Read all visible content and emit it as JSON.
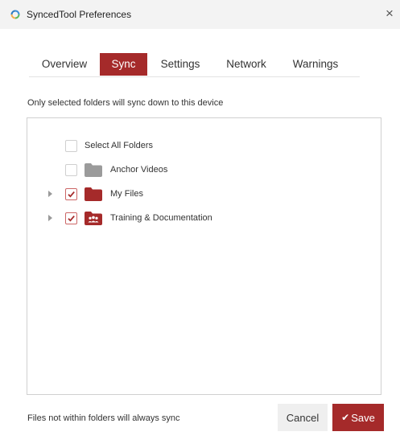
{
  "window": {
    "title": "SyncedTool Preferences",
    "app_icon": "sync-app-icon",
    "close_glyph": "×"
  },
  "tabs": [
    {
      "label": "Overview",
      "active": false
    },
    {
      "label": "Sync",
      "active": true
    },
    {
      "label": "Settings",
      "active": false
    },
    {
      "label": "Network",
      "active": false
    },
    {
      "label": "Warnings",
      "active": false
    }
  ],
  "sync": {
    "subtitle": "Only selected folders will sync down to this device",
    "select_all": {
      "label": "Select All Folders",
      "checked": false
    },
    "folders": [
      {
        "label": "Anchor Videos",
        "checked": false,
        "expandable": false,
        "icon": "folder-icon",
        "icon_color": "#9b9b9b"
      },
      {
        "label": "My Files",
        "checked": true,
        "expandable": true,
        "icon": "folder-icon",
        "icon_color": "#a52a2a"
      },
      {
        "label": "Training & Documentation",
        "checked": true,
        "expandable": true,
        "icon": "shared-folder-icon",
        "icon_color": "#a52a2a"
      }
    ]
  },
  "footer": {
    "note": "Files not within folders will always sync",
    "cancel_label": "Cancel",
    "save_label": "Save",
    "save_icon": "checkmark-icon"
  },
  "colors": {
    "accent": "#a52a2a",
    "checkbox_checked_border": "#cc6666",
    "folder_gray": "#9b9b9b"
  }
}
